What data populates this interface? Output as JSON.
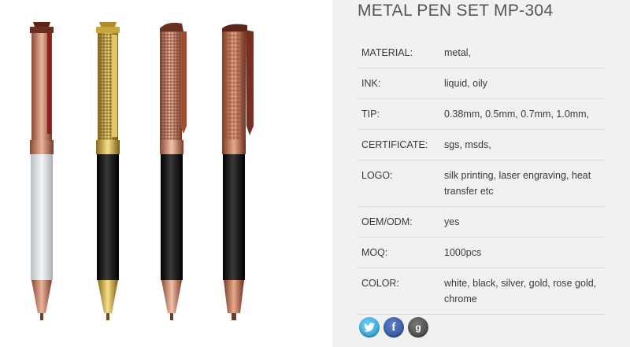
{
  "product": {
    "title": "METAL PEN SET MP-304"
  },
  "specs": [
    {
      "key": "MATERIAL:",
      "value": "metal,"
    },
    {
      "key": "INK:",
      "value": "liquid, oily"
    },
    {
      "key": "TIP:",
      "value": "0.38mm, 0.5mm, 0.7mm, 1.0mm,"
    },
    {
      "key": "CERTIFICATE:",
      "value": "sgs, msds,"
    },
    {
      "key": "LOGO:",
      "value": "silk printing, laser engraving, heat transfer etc"
    },
    {
      "key": "OEM/ODM:",
      "value": "yes"
    },
    {
      "key": "MOQ:",
      "value": "1000pcs"
    },
    {
      "key": "COLOR:",
      "value": "white, black, silver, gold, rose gold, chrome"
    }
  ],
  "social": {
    "twitter_icon": "twitter-icon",
    "facebook_label": "f",
    "googleplus_label": "g"
  },
  "pens": [
    {
      "name": "white-rose-gold-pen",
      "body": "#dfe3e6",
      "trim": "#c98a6a"
    },
    {
      "name": "black-gold-pen",
      "body": "#151515",
      "trim": "#d9b24a"
    },
    {
      "name": "black-rose-grid-pen",
      "body": "#141414",
      "trim": "#cf8f6e"
    },
    {
      "name": "black-copper-pen",
      "body": "#111111",
      "trim": "#b8674a"
    }
  ]
}
